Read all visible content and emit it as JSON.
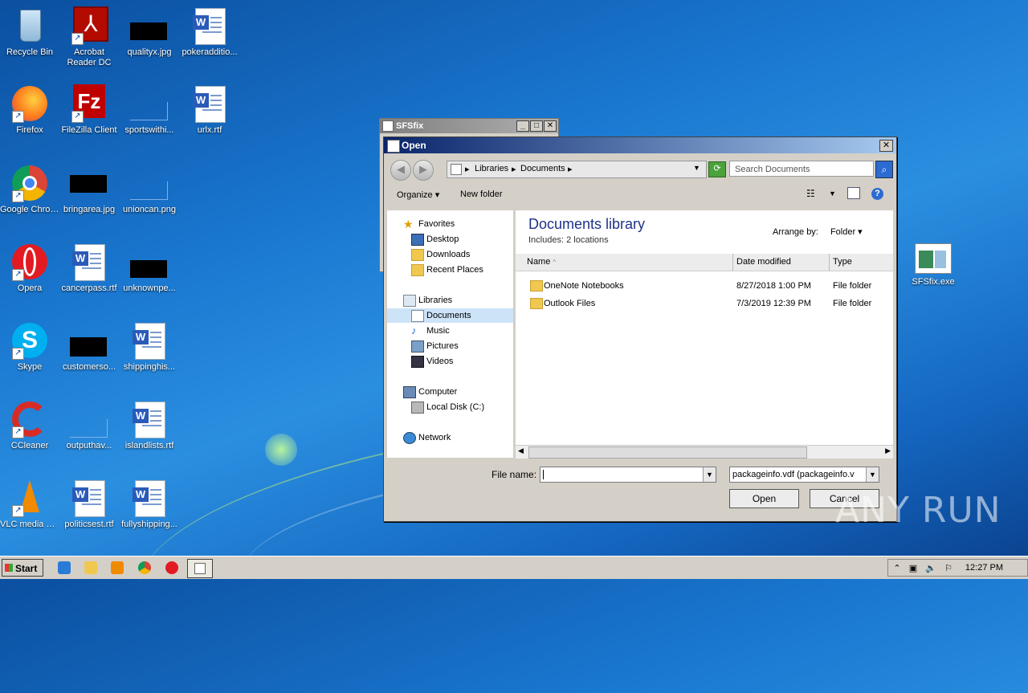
{
  "desktop": {
    "icons": [
      {
        "label": "Recycle Bin"
      },
      {
        "label": "Acrobat Reader DC"
      },
      {
        "label": "qualityx.jpg"
      },
      {
        "label": "pokeradditio..."
      },
      {
        "label": "Firefox"
      },
      {
        "label": "FileZilla Client"
      },
      {
        "label": "sportswithi..."
      },
      {
        "label": "urlx.rtf"
      },
      {
        "label": "Google Chrome"
      },
      {
        "label": "bringarea.jpg"
      },
      {
        "label": "unioncan.png"
      },
      {
        "label": "Opera"
      },
      {
        "label": "cancerpass.rtf"
      },
      {
        "label": "unknownpe..."
      },
      {
        "label": "Skype"
      },
      {
        "label": "customerso..."
      },
      {
        "label": "shippinghis..."
      },
      {
        "label": "CCleaner"
      },
      {
        "label": "outputhav..."
      },
      {
        "label": "islandlists.rtf"
      },
      {
        "label": "VLC media player"
      },
      {
        "label": "politicsest.rtf"
      },
      {
        "label": "fullyshipping..."
      },
      {
        "label": "SFSfix.exe"
      }
    ]
  },
  "sfsfix_window": {
    "title": "SFSfix"
  },
  "open_dialog": {
    "title": "Open",
    "address": {
      "parts": [
        "Libraries",
        "Documents"
      ]
    },
    "search_placeholder": "Search Documents",
    "toolbar": {
      "organize": "Organize",
      "new_folder": "New folder"
    },
    "nav": {
      "favorites": "Favorites",
      "desktop": "Desktop",
      "downloads": "Downloads",
      "recent_places": "Recent Places",
      "libraries": "Libraries",
      "documents": "Documents",
      "music": "Music",
      "pictures": "Pictures",
      "videos": "Videos",
      "computer": "Computer",
      "local_disk": "Local Disk (C:)",
      "network": "Network"
    },
    "library_title": "Documents library",
    "library_includes": "Includes:  2 locations",
    "arrange_by_label": "Arrange by:",
    "arrange_by_value": "Folder",
    "columns": {
      "name": "Name",
      "date": "Date modified",
      "type": "Type"
    },
    "rows": [
      {
        "name": "OneNote Notebooks",
        "date": "8/27/2018 1:00 PM",
        "type": "File folder"
      },
      {
        "name": "Outlook Files",
        "date": "7/3/2019 12:39 PM",
        "type": "File folder"
      }
    ],
    "file_name_label": "File name:",
    "file_name_value": "",
    "filter_value": "packageinfo.vdf (packageinfo.v",
    "open_button": "Open",
    "cancel_button": "Cancel"
  },
  "taskbar": {
    "start_label": "Start",
    "clock": "12:27 PM"
  },
  "watermark": "ANY RUN"
}
